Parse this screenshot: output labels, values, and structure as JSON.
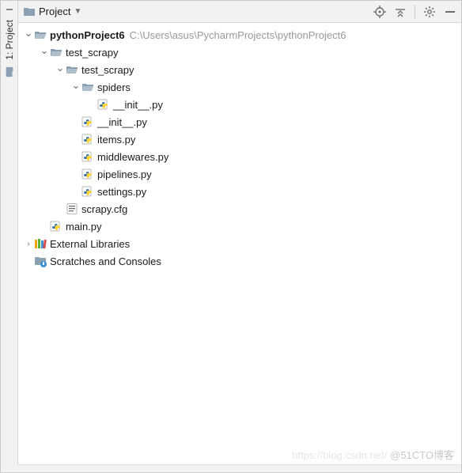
{
  "sidebar": {
    "tab_label": "1: Project"
  },
  "toolbar": {
    "title": "Project"
  },
  "tree": {
    "nodes": [
      {
        "depth": 0,
        "chev": "down",
        "icon": "folder-open",
        "label": "pythonProject6",
        "bold": true,
        "path": "C:\\Users\\asus\\PycharmProjects\\pythonProject6"
      },
      {
        "depth": 1,
        "chev": "down",
        "icon": "folder-open",
        "label": "test_scrapy"
      },
      {
        "depth": 2,
        "chev": "down",
        "icon": "folder-open",
        "label": "test_scrapy"
      },
      {
        "depth": 3,
        "chev": "down",
        "icon": "folder-open",
        "label": "spiders"
      },
      {
        "depth": 4,
        "chev": "none",
        "icon": "python",
        "label": "__init__.py"
      },
      {
        "depth": 3,
        "chev": "none",
        "icon": "python",
        "label": "__init__.py"
      },
      {
        "depth": 3,
        "chev": "none",
        "icon": "python",
        "label": "items.py"
      },
      {
        "depth": 3,
        "chev": "none",
        "icon": "python",
        "label": "middlewares.py"
      },
      {
        "depth": 3,
        "chev": "none",
        "icon": "python",
        "label": "pipelines.py"
      },
      {
        "depth": 3,
        "chev": "none",
        "icon": "python",
        "label": "settings.py"
      },
      {
        "depth": 2,
        "chev": "none",
        "icon": "cfg",
        "label": "scrapy.cfg"
      },
      {
        "depth": 1,
        "chev": "none",
        "icon": "python",
        "label": "main.py"
      },
      {
        "depth": 0,
        "chev": "right",
        "icon": "libraries",
        "label": "External Libraries"
      },
      {
        "depth": 0,
        "chev": "none",
        "icon": "scratches",
        "label": "Scratches and Consoles"
      }
    ]
  },
  "watermark": {
    "faint": "https://blog.csdn.net/",
    "main": "@51CTO博客"
  }
}
